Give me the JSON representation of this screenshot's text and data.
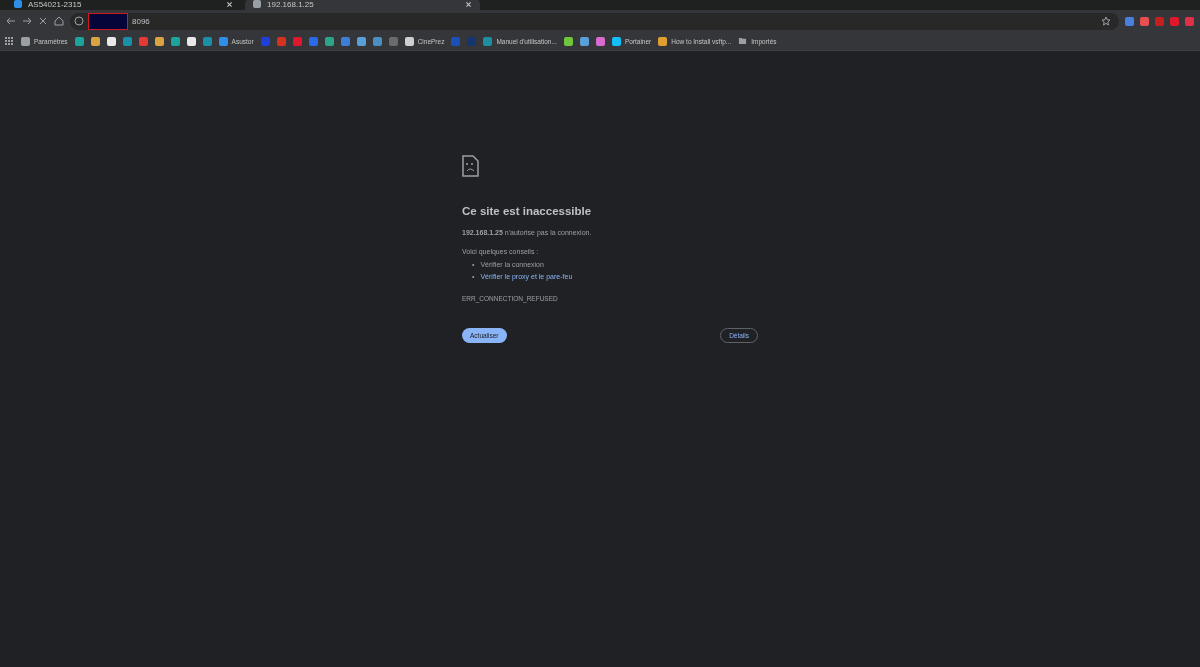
{
  "tabs": [
    {
      "label": "AS54021-2315",
      "selected": false
    },
    {
      "label": "192.168.1.25",
      "selected": true
    }
  ],
  "address_bar": {
    "value": "8096",
    "redacted": true
  },
  "bookmarks": [
    {
      "kind": "labeled",
      "label": "Paramètres",
      "color": "#9aa0a6"
    },
    {
      "kind": "icon",
      "color": "#1ba39c"
    },
    {
      "kind": "icon",
      "color": "#d9a441"
    },
    {
      "kind": "icon",
      "color": "#e8e8e8"
    },
    {
      "kind": "icon",
      "color": "#1c8fa8"
    },
    {
      "kind": "icon",
      "color": "#e53935"
    },
    {
      "kind": "icon",
      "color": "#d9a441"
    },
    {
      "kind": "icon",
      "color": "#1ba39c"
    },
    {
      "kind": "icon",
      "color": "#e8e8e8"
    },
    {
      "kind": "icon",
      "color": "#1c8fa8"
    },
    {
      "kind": "labeled",
      "label": "Asustor",
      "color": "#2f8fe8"
    },
    {
      "kind": "icon",
      "color": "#1e40d8"
    },
    {
      "kind": "icon",
      "color": "#d6331f"
    },
    {
      "kind": "icon",
      "color": "#e0182d"
    },
    {
      "kind": "icon",
      "color": "#2a6ae8"
    },
    {
      "kind": "icon",
      "color": "#2aa58a"
    },
    {
      "kind": "icon",
      "color": "#3d7fd6"
    },
    {
      "kind": "icon",
      "color": "#5aa0d8"
    },
    {
      "kind": "icon",
      "color": "#4a8fbf"
    },
    {
      "kind": "icon",
      "color": "#6b6b6b"
    },
    {
      "kind": "labeled",
      "label": "CinePrez",
      "color": "#cfcfcf"
    },
    {
      "kind": "icon",
      "color": "#1d4fb8"
    },
    {
      "kind": "icon",
      "color": "#15356e"
    },
    {
      "kind": "labeled",
      "label": "Manuel d'utilisation...",
      "color": "#1d8fa0"
    },
    {
      "kind": "icon",
      "color": "#6ec63c"
    },
    {
      "kind": "icon",
      "color": "#5aa0d8"
    },
    {
      "kind": "icon",
      "color": "#d86ad0"
    },
    {
      "kind": "labeled",
      "label": "Portainer",
      "color": "#13bef9"
    },
    {
      "kind": "labeled",
      "label": "How to Install vsftp...",
      "color": "#e0a030"
    },
    {
      "kind": "folder",
      "label": "Importés",
      "color": "#9aa0a6"
    }
  ],
  "extensions": [
    {
      "color": "#4a7fe0"
    },
    {
      "color": "#e85050"
    },
    {
      "color": "#c41e1e"
    },
    {
      "color": "#e0182d"
    },
    {
      "color": "#e0304a"
    }
  ],
  "error": {
    "title": "Ce site est inaccessible",
    "host": "192.168.1.25",
    "message": "n'autorise pas la connexion.",
    "tips_heading": "Voici quelques conseils :",
    "tips": [
      {
        "kind": "text",
        "marker": "•",
        "label": "Vérifier la connexion"
      },
      {
        "kind": "link",
        "marker": "•",
        "label": "Vérifier le proxy et le pare-feu"
      }
    ],
    "code": "ERR_CONNECTION_REFUSED",
    "reload_button": "Actualiser",
    "details_button": "Détails"
  }
}
